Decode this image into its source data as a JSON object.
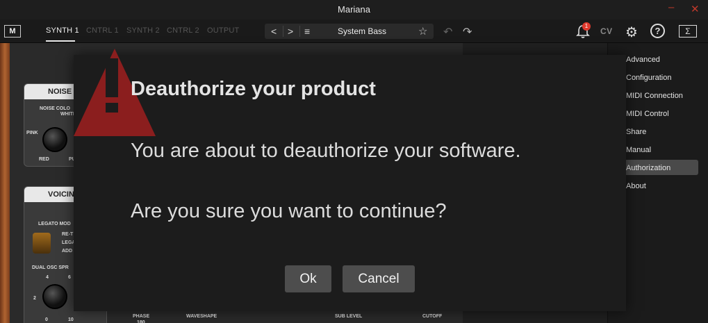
{
  "window": {
    "title": "Mariana"
  },
  "toolbar": {
    "logo": "M",
    "tabs": [
      "SYNTH 1",
      "CNTRL 1",
      "SYNTH 2",
      "CNTRL 2",
      "OUTPUT"
    ],
    "active_tab": "SYNTH 1",
    "preset_prev": "<",
    "preset_next": ">",
    "preset_menu": "≡",
    "preset_name": "System Bass",
    "notification_count": "1",
    "cv_label": "CV",
    "help_label": "?",
    "sigma_label": "Σ"
  },
  "synth": {
    "noise_panel": {
      "title": "NOISE",
      "color_label": "NOISE COLO",
      "white": "WHITE",
      "pink": "PINK",
      "red": "RED",
      "pu": "PU"
    },
    "voicing_panel": {
      "title": "VOICING",
      "legato_label": "LEGATO MOD",
      "retrig": "RE-T",
      "lega": "LEGA",
      "add": "ADD",
      "dual_osc": "DUAL OSC SPR",
      "k4": "4",
      "k6": "6",
      "k2": "2",
      "k0": "0",
      "k10": "10"
    },
    "bottom_labels": {
      "phase": "PHASE",
      "phase_val": "180",
      "waveshape": "WAVESHAPE",
      "sub_level": "SUB LEVEL",
      "cutoff": "CUTOFF"
    }
  },
  "settings_menu": {
    "items": [
      "Advanced",
      "Configuration",
      "MIDI Connection",
      "MIDI Control",
      "Share",
      "Manual",
      "Authorization",
      "About"
    ],
    "active": "Authorization"
  },
  "dialog": {
    "title": "Deauthorize your product",
    "message1": "You are about to deauthorize your software.",
    "message2": "Are you sure you want to continue?",
    "ok_label": "Ok",
    "cancel_label": "Cancel",
    "warning_color": "#8b1e1e"
  }
}
